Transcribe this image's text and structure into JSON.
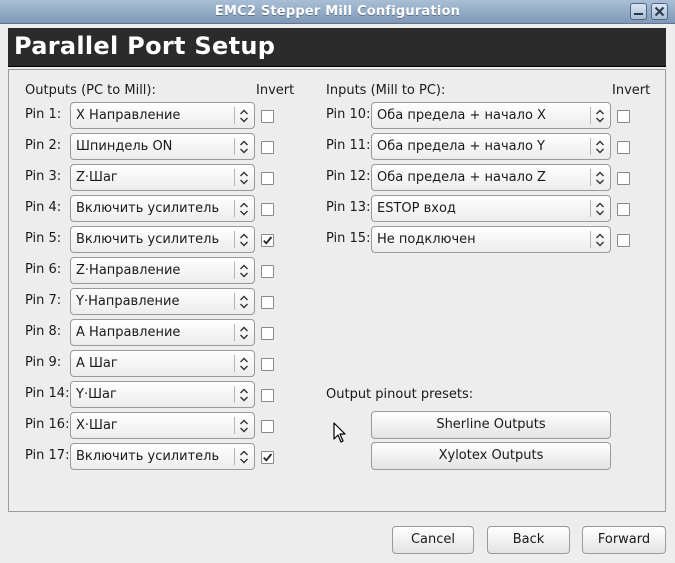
{
  "window": {
    "title": "EMC2 Stepper Mill Configuration"
  },
  "page_title": "Parallel Port Setup",
  "outputs": {
    "header": "Outputs (PC to Mill):",
    "invert_label": "Invert",
    "rows": [
      {
        "pin": "Pin 1:",
        "value": "X Направление",
        "inverted": false
      },
      {
        "pin": "Pin 2:",
        "value": "Шпиндель ON",
        "inverted": false
      },
      {
        "pin": "Pin 3:",
        "value": "Z·Шаг",
        "inverted": false
      },
      {
        "pin": "Pin 4:",
        "value": "Включить усилитель",
        "inverted": false
      },
      {
        "pin": "Pin 5:",
        "value": "Включить усилитель",
        "inverted": true
      },
      {
        "pin": "Pin 6:",
        "value": "Z·Направление",
        "inverted": false
      },
      {
        "pin": "Pin 7:",
        "value": "Y·Направление",
        "inverted": false
      },
      {
        "pin": "Pin 8:",
        "value": "A Направление",
        "inverted": false
      },
      {
        "pin": "Pin 9:",
        "value": "A Шаг",
        "inverted": false
      },
      {
        "pin": "Pin 14:",
        "value": "Y·Шаг",
        "inverted": false
      },
      {
        "pin": "Pin 16:",
        "value": "X·Шаг",
        "inverted": false
      },
      {
        "pin": "Pin 17:",
        "value": "Включить усилитель",
        "inverted": true
      }
    ]
  },
  "inputs": {
    "header": "Inputs (Mill to PC):",
    "invert_label": "Invert",
    "rows": [
      {
        "pin": "Pin 10:",
        "value": "Оба предела + начало X",
        "inverted": false
      },
      {
        "pin": "Pin 11:",
        "value": "Оба предела + начало Y",
        "inverted": false
      },
      {
        "pin": "Pin 12:",
        "value": "Оба предела + начало Z",
        "inverted": false
      },
      {
        "pin": "Pin 13:",
        "value": "ESTOP вход",
        "inverted": false
      },
      {
        "pin": "Pin 15:",
        "value": "Не подключен",
        "inverted": false
      }
    ]
  },
  "presets": {
    "header": "Output pinout presets:",
    "sherline": "Sherline Outputs",
    "xylotex": "Xylotex Outputs"
  },
  "footer": {
    "cancel": "Cancel",
    "back": "Back",
    "forward": "Forward"
  },
  "icons": {
    "minimize": "minimize-icon",
    "close": "close-icon",
    "combo_arrow": "updown-arrow-icon",
    "check": "check-icon",
    "cursor": "mouse-pointer-icon"
  }
}
